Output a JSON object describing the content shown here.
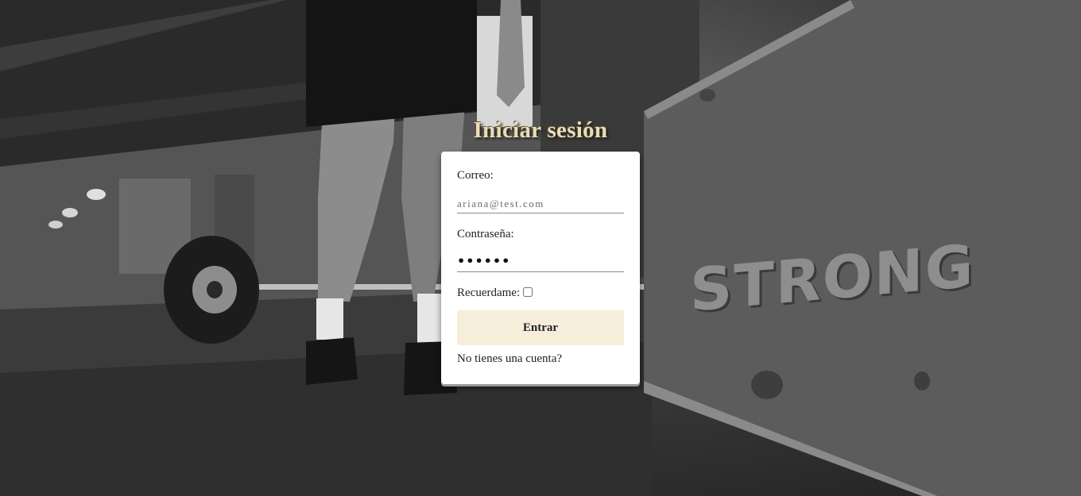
{
  "background": {
    "description_icon": "gym-background-image",
    "box_text": "STRONG"
  },
  "login": {
    "title": "Iniciar sesión",
    "email_label": "Correo:",
    "email_placeholder": "ariana@test.com",
    "password_label": "Contraseña:",
    "password_mask": "••••••",
    "remember_label": "Recuerdame:",
    "remember_checked": false,
    "submit_label": "Entrar",
    "register_link": "No tienes una cuenta?"
  },
  "colors": {
    "title": "#e9dcb8",
    "button_bg": "#f6eedb",
    "card_bg": "#ffffff"
  }
}
